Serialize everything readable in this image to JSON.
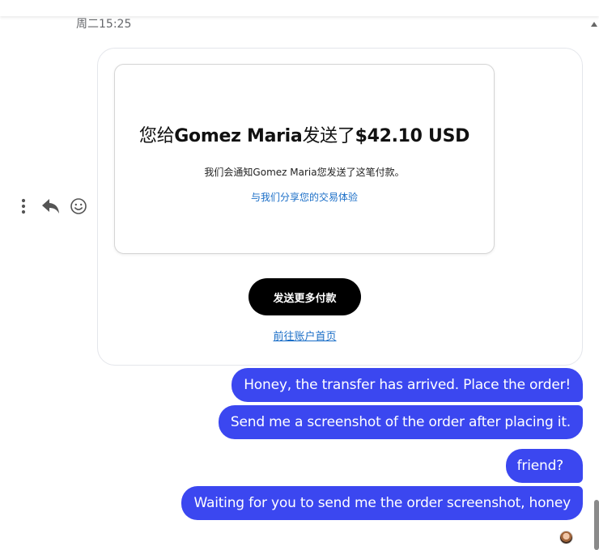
{
  "conversation": {
    "timestamp": "周二15:25"
  },
  "payment_card": {
    "heading_prefix": "您给",
    "recipient": "Gomez Maria",
    "heading_mid": "发送了",
    "amount": "$42.10 USD",
    "notice": "我们会通知Gomez Maria您发送了这笔付款。",
    "share_link": "与我们分享您的交易体验",
    "send_more_button": "发送更多付款",
    "home_link": "前往账户首页"
  },
  "message_actions": {
    "icons": [
      "more-options-icon",
      "reply-icon",
      "react-emoji-icon"
    ]
  },
  "messages": [
    {
      "text": "Honey, the transfer has arrived. Place the order!"
    },
    {
      "text": "Send me a screenshot of the order after placing it."
    },
    {
      "text": "friend?"
    },
    {
      "text": "Waiting for you to send me the order screenshot, honey"
    }
  ],
  "colors": {
    "outgoing_bubble": "#3b47f0",
    "link": "#1a6ec7",
    "button": "#000000"
  }
}
